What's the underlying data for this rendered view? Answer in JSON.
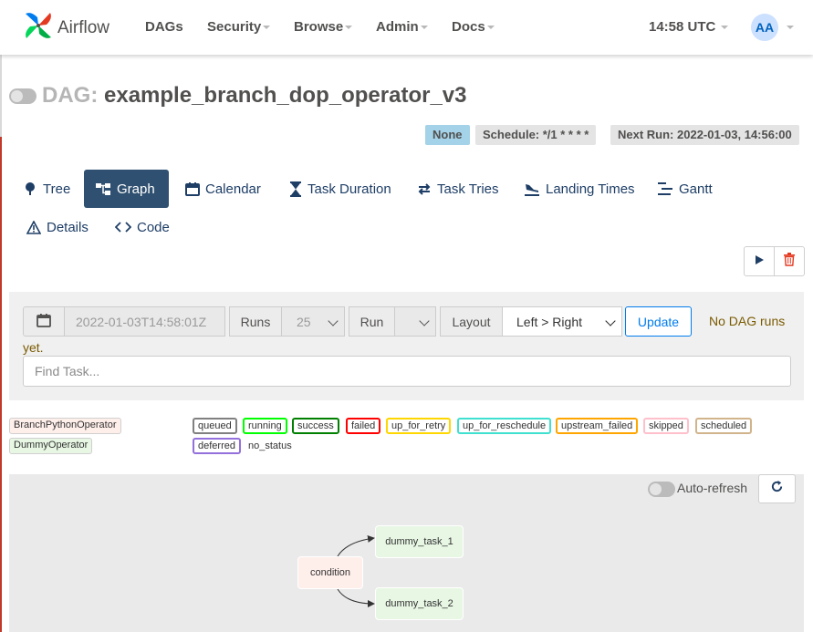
{
  "navbar": {
    "brand": "Airflow",
    "menu": [
      {
        "label": "DAGs",
        "dropdown": false
      },
      {
        "label": "Security",
        "dropdown": true
      },
      {
        "label": "Browse",
        "dropdown": true
      },
      {
        "label": "Admin",
        "dropdown": true
      },
      {
        "label": "Docs",
        "dropdown": true
      }
    ],
    "time": "14:58 UTC",
    "avatar": "AA"
  },
  "dag": {
    "prefix": "DAG:",
    "name": "example_branch_dop_operator_v3",
    "labels": {
      "status": "None",
      "schedule": "Schedule: */1 * * * *",
      "next_run": "Next Run: 2022-01-03, 14:56:00"
    }
  },
  "tabs": [
    {
      "label": "Tree",
      "icon": "tree-icon",
      "active": false
    },
    {
      "label": "Graph",
      "icon": "graph-icon",
      "active": true
    },
    {
      "label": "Calendar",
      "icon": "calendar-icon",
      "active": false
    },
    {
      "label": "Task Duration",
      "icon": "hourglass-icon",
      "active": false
    },
    {
      "label": "Task Tries",
      "icon": "retry-icon",
      "active": false
    },
    {
      "label": "Landing Times",
      "icon": "plane-landing-icon",
      "active": false
    },
    {
      "label": "Gantt",
      "icon": "gantt-icon",
      "active": false
    },
    {
      "label": "Details",
      "icon": "warning-triangle-icon",
      "active": false
    },
    {
      "label": "Code",
      "icon": "code-icon",
      "active": false
    }
  ],
  "actions": {
    "trigger": "play-icon",
    "delete": "trash-icon"
  },
  "filter": {
    "date_value": "2022-01-03T14:58:01Z",
    "runs_label": "Runs",
    "runs_value": "25",
    "run_label": "Run",
    "run_value": "",
    "layout_label": "Layout",
    "layout_value": "Left > Right",
    "update_label": "Update",
    "no_runs_line1": "No DAG runs",
    "no_runs_line2": "yet.",
    "find_placeholder": "Find Task..."
  },
  "operator_legend": [
    {
      "label": "BranchPythonOperator",
      "color": "#ffefeb"
    },
    {
      "label": "DummyOperator",
      "color": "#e8f7e4"
    }
  ],
  "state_legend": [
    {
      "label": "queued",
      "color": "#808080"
    },
    {
      "label": "running",
      "color": "#00ff00"
    },
    {
      "label": "success",
      "color": "#008000"
    },
    {
      "label": "failed",
      "color": "#ff0000"
    },
    {
      "label": "up_for_retry",
      "color": "#ffd700"
    },
    {
      "label": "up_for_reschedule",
      "color": "#40e0d0"
    },
    {
      "label": "upstream_failed",
      "color": "#ffa500"
    },
    {
      "label": "skipped",
      "color": "#ffc0cb"
    },
    {
      "label": "scheduled",
      "color": "#d2b48c"
    },
    {
      "label": "deferred",
      "color": "#9370db"
    },
    {
      "label": "no_status",
      "color": ""
    }
  ],
  "graph": {
    "auto_refresh_label": "Auto-refresh",
    "nodes": [
      {
        "id": "condition",
        "label": "condition",
        "operator": "BranchPythonOperator"
      },
      {
        "id": "dummy_task_1",
        "label": "dummy_task_1",
        "operator": "DummyOperator"
      },
      {
        "id": "dummy_task_2",
        "label": "dummy_task_2",
        "operator": "DummyOperator"
      }
    ],
    "edges": [
      [
        "condition",
        "dummy_task_1"
      ],
      [
        "condition",
        "dummy_task_2"
      ]
    ]
  }
}
